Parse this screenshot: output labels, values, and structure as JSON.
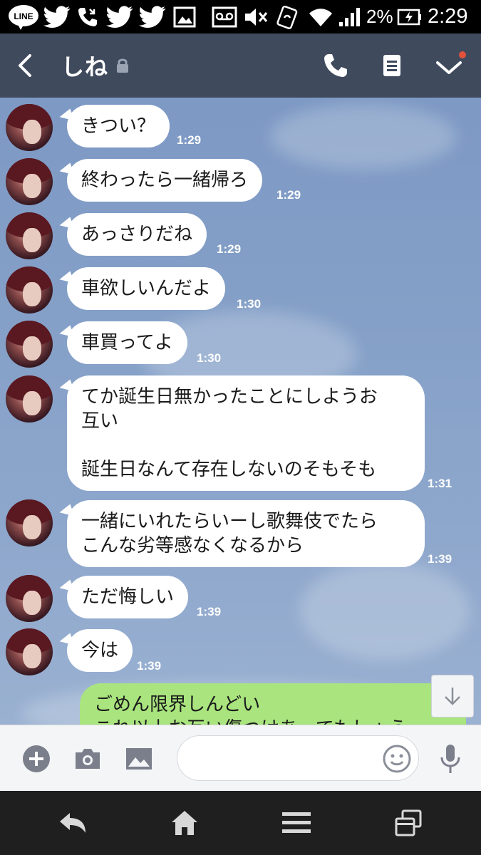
{
  "status_bar": {
    "battery_percent": "2%",
    "time": "2:29",
    "icons": [
      "line-app-icon",
      "twitter-icon",
      "missed-call-icon",
      "twitter-icon",
      "twitter-icon",
      "gallery-icon",
      "voicemail-icon",
      "mute-icon",
      "nfc-icon",
      "wifi-icon",
      "signal-icon",
      "battery-charging-icon"
    ]
  },
  "header": {
    "title": "しね",
    "icons": [
      "back-icon",
      "lock-icon",
      "phone-icon",
      "notes-icon",
      "chevron-down-icon"
    ],
    "accent_dot_color": "#e2513b",
    "background": "#3f4a5d"
  },
  "chat": {
    "messages": [
      {
        "text": "きつい？",
        "time": "1:29"
      },
      {
        "text": "終わったら一緒帰ろ",
        "time": "1:29"
      },
      {
        "text": "あっさりだね",
        "time": "1:29"
      },
      {
        "text": "車欲しいんだよ",
        "time": "1:30"
      },
      {
        "text": "車買ってよ",
        "time": "1:30"
      },
      {
        "text": "てか誕生日無かったことにしようお\n互い\n\n誕生日なんて存在しないのそもそも",
        "time": "1:31"
      },
      {
        "text": "一緒にいれたらいーし歌舞伎でたら\nこんな劣等感なくなるから",
        "time": "1:39"
      },
      {
        "text": "ただ悔しい",
        "time": "1:39"
      },
      {
        "text": "今は",
        "time": "1:39"
      }
    ],
    "outgoing": {
      "line1": "ごめん限界しんどい",
      "line2": "これ以上お互い傷つけあってもしょう"
    },
    "outgoing_color": "#a9e47e"
  },
  "input_bar": {
    "placeholder": "",
    "icons": [
      "plus-icon",
      "camera-icon",
      "image-icon",
      "emoji-icon",
      "mic-icon"
    ]
  },
  "nav_bar": {
    "icons": [
      "nav-back-icon",
      "home-icon",
      "menu-icon",
      "recent-apps-icon"
    ]
  }
}
